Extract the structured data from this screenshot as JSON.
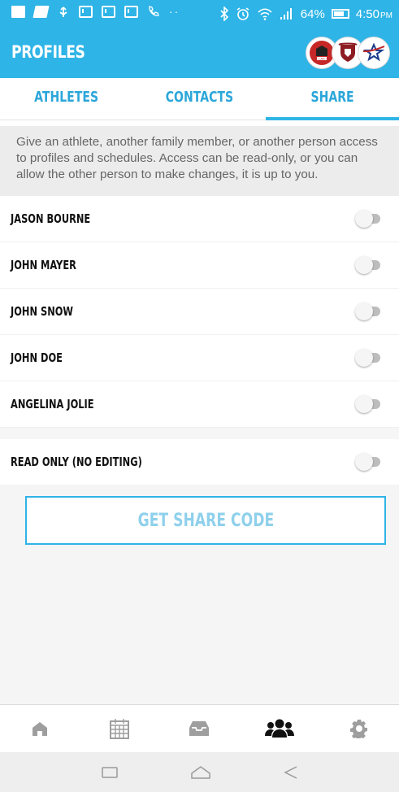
{
  "status_bar": {
    "battery": "64%",
    "time": "4:50",
    "ampm": "PM",
    "icons": [
      "notification-icon",
      "notes-icon",
      "usb-icon",
      "mail-icon",
      "mail-icon",
      "mail-icon",
      "phone-icon",
      "bluetooth-icon",
      "alarm-icon",
      "wifi-icon",
      "signal-icon",
      "battery-icon"
    ]
  },
  "header": {
    "title": "PROFILES",
    "logos": [
      "team-logo-lax",
      "team-logo-shield",
      "team-logo-star"
    ]
  },
  "tabs": [
    {
      "label": "ATHLETES",
      "active": false
    },
    {
      "label": "CONTACTS",
      "active": false
    },
    {
      "label": "SHARE",
      "active": true
    }
  ],
  "info_text": "Give an athlete, another family member, or another person access to profiles and schedules. Access can be read-only, or you can allow the other person to make changes, it is up to you.",
  "people": [
    {
      "name": "JASON BOURNE",
      "enabled": false
    },
    {
      "name": "JOHN MAYER",
      "enabled": false
    },
    {
      "name": "JOHN SNOW",
      "enabled": false
    },
    {
      "name": "JOHN DOE",
      "enabled": false
    },
    {
      "name": "ANGELINA JOLIE",
      "enabled": false
    }
  ],
  "read_only": {
    "label": "READ ONLY (NO EDITING)",
    "enabled": false
  },
  "share_button": {
    "label": "GET SHARE CODE"
  },
  "bottom_nav": [
    "home-icon",
    "calendar-icon",
    "inbox-icon",
    "team-icon",
    "settings-icon"
  ],
  "colors": {
    "primary": "#2eb4e6",
    "tab_text": "#2ba6d9",
    "button_text": "#8fd0ec",
    "active_nav": "#111111",
    "inactive_nav": "#9e9e9e"
  }
}
